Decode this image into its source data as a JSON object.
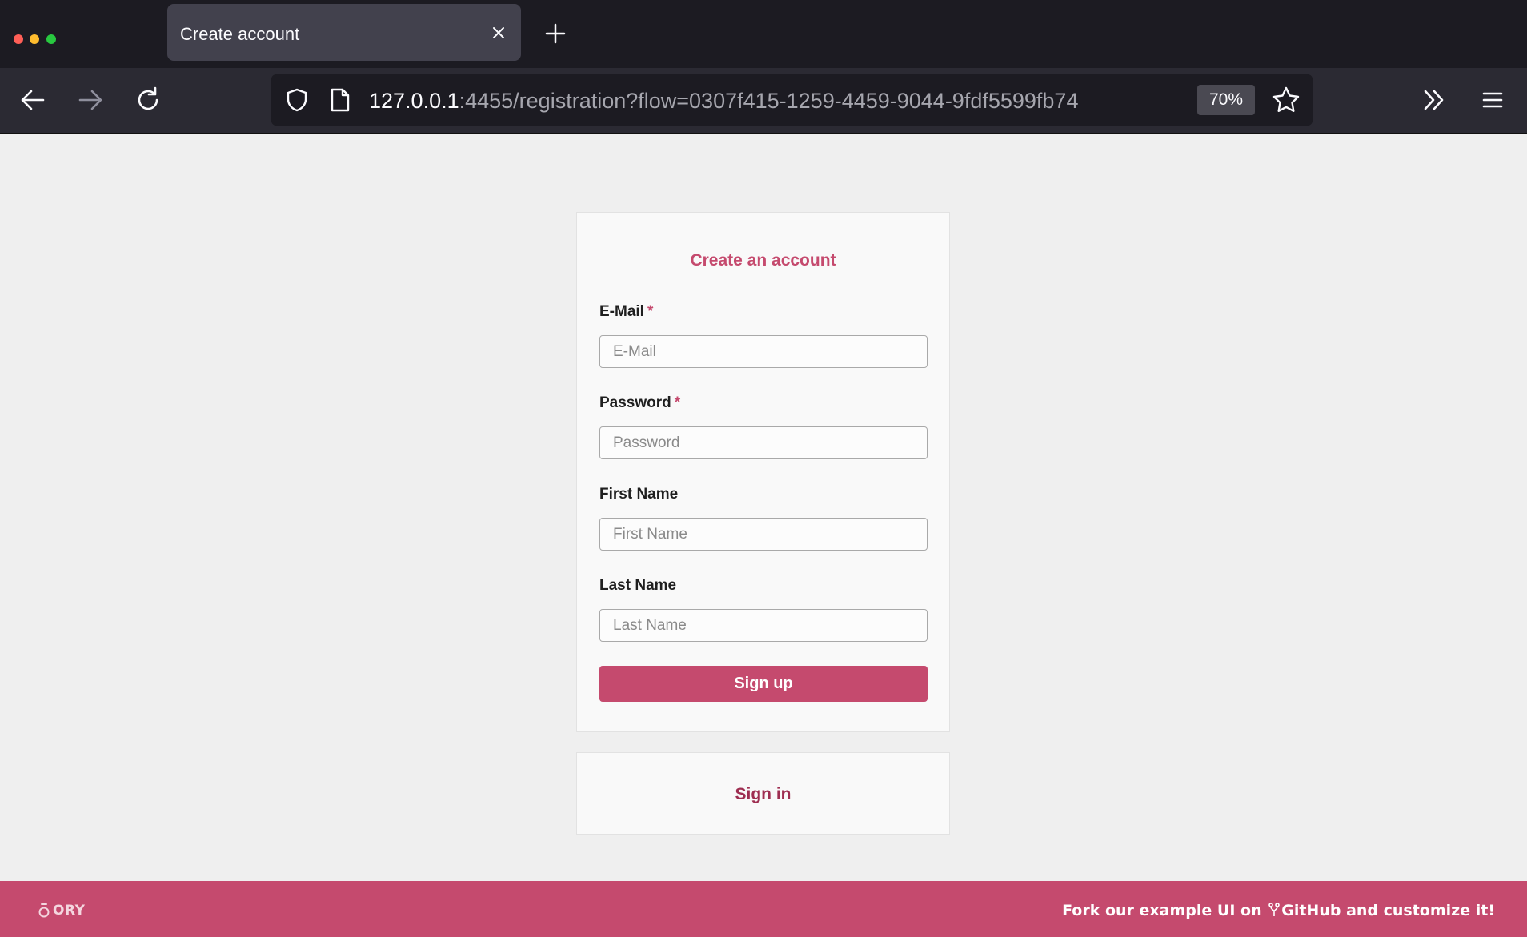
{
  "browser": {
    "tab_title": "Create account",
    "url_host": "127.0.0.1",
    "url_rest": ":4455/registration?flow=0307f415-1259-4459-9044-9fdf5599fb74",
    "zoom": "70%"
  },
  "form": {
    "title": "Create an account",
    "required_marker": "*",
    "fields": [
      {
        "label": "E-Mail",
        "placeholder": "E-Mail",
        "value": "",
        "required": true
      },
      {
        "label": "Password",
        "placeholder": "Password",
        "value": "",
        "required": true
      },
      {
        "label": "First Name",
        "placeholder": "First Name",
        "value": "",
        "required": false
      },
      {
        "label": "Last Name",
        "placeholder": "Last Name",
        "value": "",
        "required": false
      }
    ],
    "submit_label": "Sign up"
  },
  "signin": {
    "label": "Sign in"
  },
  "footer": {
    "logo_text": "ORY",
    "text_before": "Fork our example UI on ",
    "text_link": "GitHub",
    "text_after": " and customize it!"
  },
  "colors": {
    "accent": "#c54a6e",
    "link": "#9e2e51",
    "chrome_dark": "#1c1b22",
    "chrome_toolbar": "#2b2a33",
    "page_bg": "#efefef"
  },
  "icons": {
    "back": "arrow-left-icon",
    "forward": "arrow-right-icon",
    "reload": "reload-icon",
    "shield": "shield-icon",
    "page": "page-icon",
    "star": "star-icon",
    "overflow": "double-chevron-icon",
    "menu": "hamburger-menu-icon",
    "close": "close-icon",
    "new_tab": "plus-icon",
    "github": "git-fork-icon"
  }
}
